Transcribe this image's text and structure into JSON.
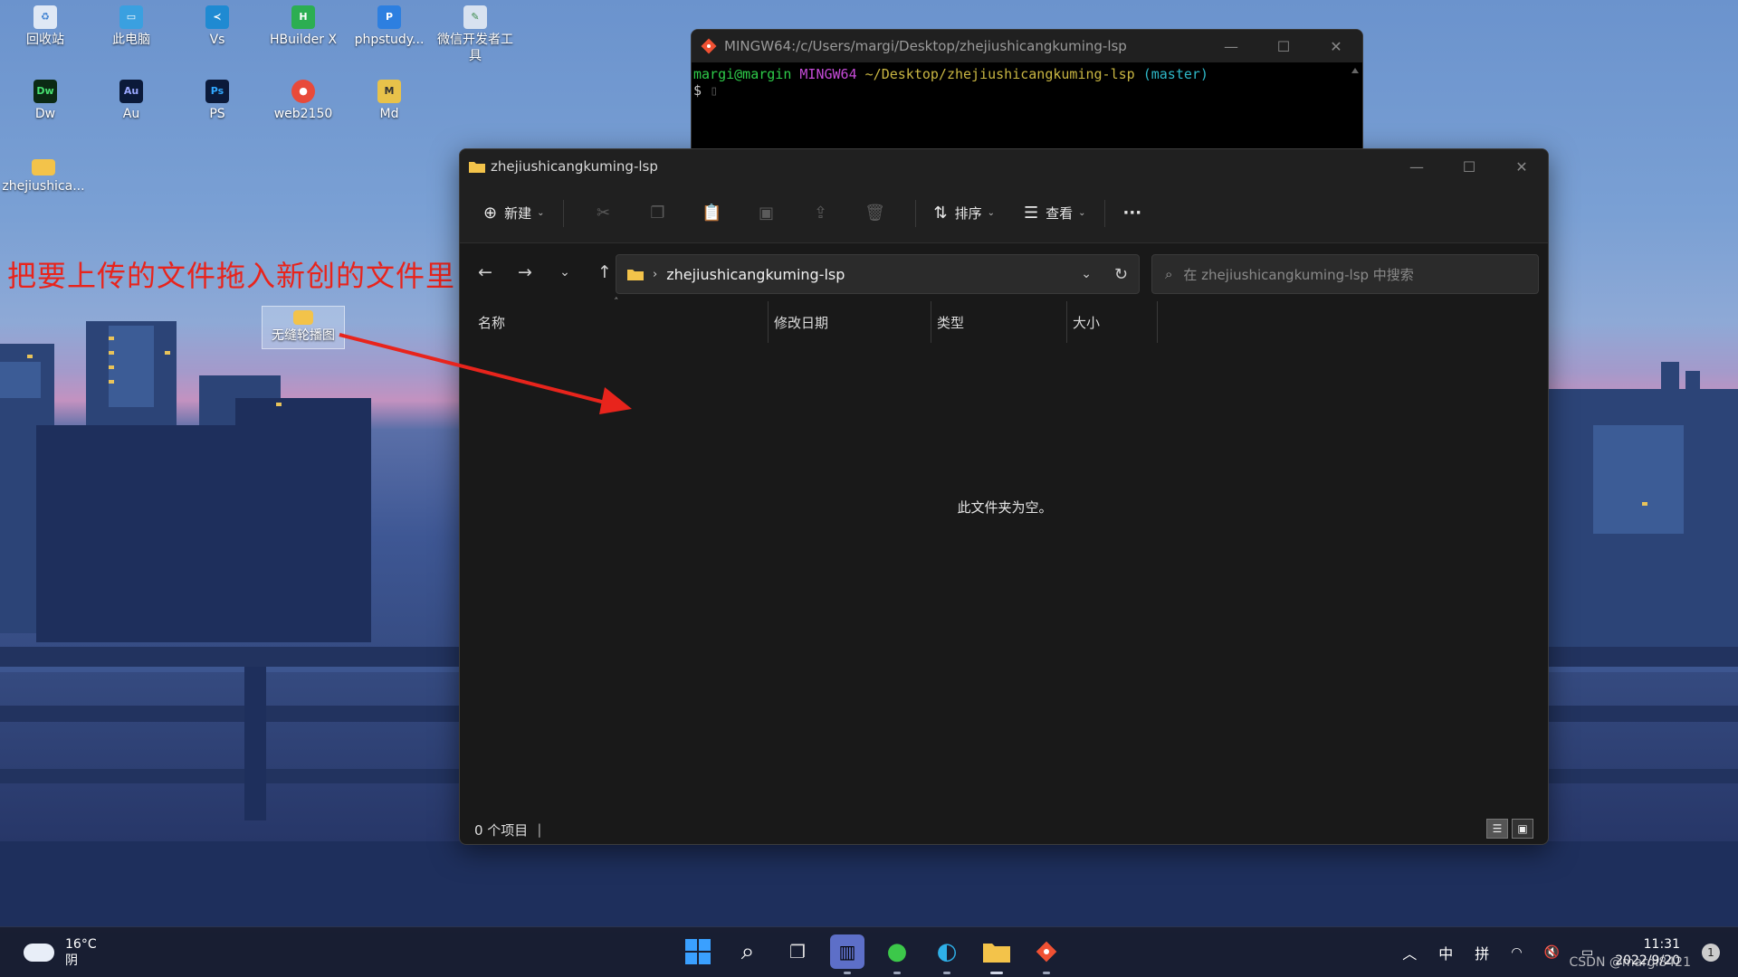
{
  "desktop": {
    "icons": [
      {
        "label": "回收站",
        "icon": "recycle-bin-icon"
      },
      {
        "label": "此电脑",
        "icon": "computer-icon"
      },
      {
        "label": "Vs",
        "icon": "vscode-icon"
      },
      {
        "label": "HBuilder X",
        "icon": "hbuilder-icon"
      },
      {
        "label": "phpstudy...",
        "icon": "phpstudy-icon"
      },
      {
        "label": "微信开发者工具",
        "icon": "wechat-devtools-icon"
      },
      {
        "label": "Dw",
        "icon": "dreamweaver-icon",
        "glyph": "Dw"
      },
      {
        "label": "Au",
        "icon": "audition-icon",
        "glyph": "Au"
      },
      {
        "label": "PS",
        "icon": "photoshop-icon",
        "glyph": "Ps"
      },
      {
        "label": "web2150",
        "icon": "web-icon"
      },
      {
        "label": "Md",
        "icon": "markdown-icon"
      },
      {
        "label": "zhejiushica...",
        "icon": "folder-icon"
      },
      {
        "label": "无缝轮播图",
        "icon": "folder-icon"
      }
    ],
    "annotation": "把要上传的文件拖入新创的文件里"
  },
  "terminal": {
    "title": "MINGW64:/c/Users/margi/Desktop/zhejiushicangkuming-lsp",
    "user_host": "margi@margin",
    "env": "MINGW64",
    "path": "~/Desktop/zhejiushicangkuming-lsp",
    "branch": "(master)",
    "prompt": "$"
  },
  "explorer": {
    "title": "zhejiushicangkuming-lsp",
    "toolbar": {
      "new_label": "新建",
      "sort_label": "排序",
      "view_label": "查看",
      "more_label": "···"
    },
    "address": {
      "path": "zhejiushicangkuming-lsp"
    },
    "search": {
      "placeholder": "在 zhejiushicangkuming-lsp 中搜索"
    },
    "columns": [
      "名称",
      "修改日期",
      "类型",
      "大小"
    ],
    "empty_message": "此文件夹为空。",
    "status": "0 个项目"
  },
  "taskbar": {
    "weather_temp": "16°C",
    "weather_desc": "阴",
    "ime_lang": "中",
    "ime_mode": "拼",
    "time": "11:31",
    "date": "2022/9/20",
    "notification_count": "1",
    "watermark": "CSDN @margi8421"
  },
  "colors": {
    "accent": "#0a84ff",
    "annotation_red": "#e8241c",
    "explorer_bg": "#191919"
  }
}
